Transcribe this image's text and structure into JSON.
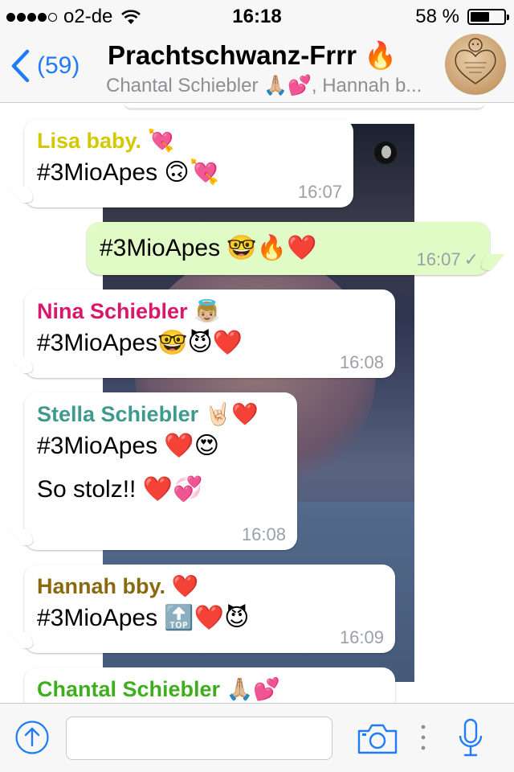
{
  "status_bar": {
    "carrier": "o2-de",
    "signal_bars_filled": 4,
    "signal_bars_total": 5,
    "time": "16:18",
    "battery_percent": "58 %",
    "battery_level": 0.58
  },
  "nav": {
    "back_count": "(59)",
    "title": "Prachtschwanz-Frrr 🔥",
    "subtitle": "Chantal Schiebler 🙏🏼💕, Hannah b..."
  },
  "colors": {
    "accent": "#1f7cf6",
    "outgoing_bubble": "#e1fbc6",
    "lisa": "#d4c800",
    "nina": "#d8176d",
    "stella": "#3e9a8e",
    "hannah": "#8a6a10",
    "chantal": "#3fae1e"
  },
  "messages": [
    {
      "sender": "Lisa baby. 💘",
      "lines": [
        "#3MioApes 🙃💘"
      ],
      "time": "16:07"
    },
    {
      "lines": [
        "#3MioApes 🤓🔥❤️"
      ],
      "time": "16:07",
      "status": "✓"
    },
    {
      "sender": "Nina Schiebler 👼🏼",
      "lines": [
        "#3MioApes🤓😈❤️"
      ],
      "time": "16:08"
    },
    {
      "sender": "Stella Schiebler 🤘🏻❤️",
      "lines": [
        "#3MioApes ❤️😍",
        "So stolz!! ❤️💞"
      ],
      "time": "16:08"
    },
    {
      "sender": "Hannah bby. ❤️",
      "lines": [
        "#3MioApes 🔝❤️😈"
      ],
      "time": "16:09"
    },
    {
      "sender": "Chantal Schiebler 🙏🏼💕"
    }
  ],
  "input": {
    "placeholder": "",
    "icons": [
      "share-icon",
      "camera-icon",
      "more-icon",
      "microphone-icon"
    ]
  }
}
